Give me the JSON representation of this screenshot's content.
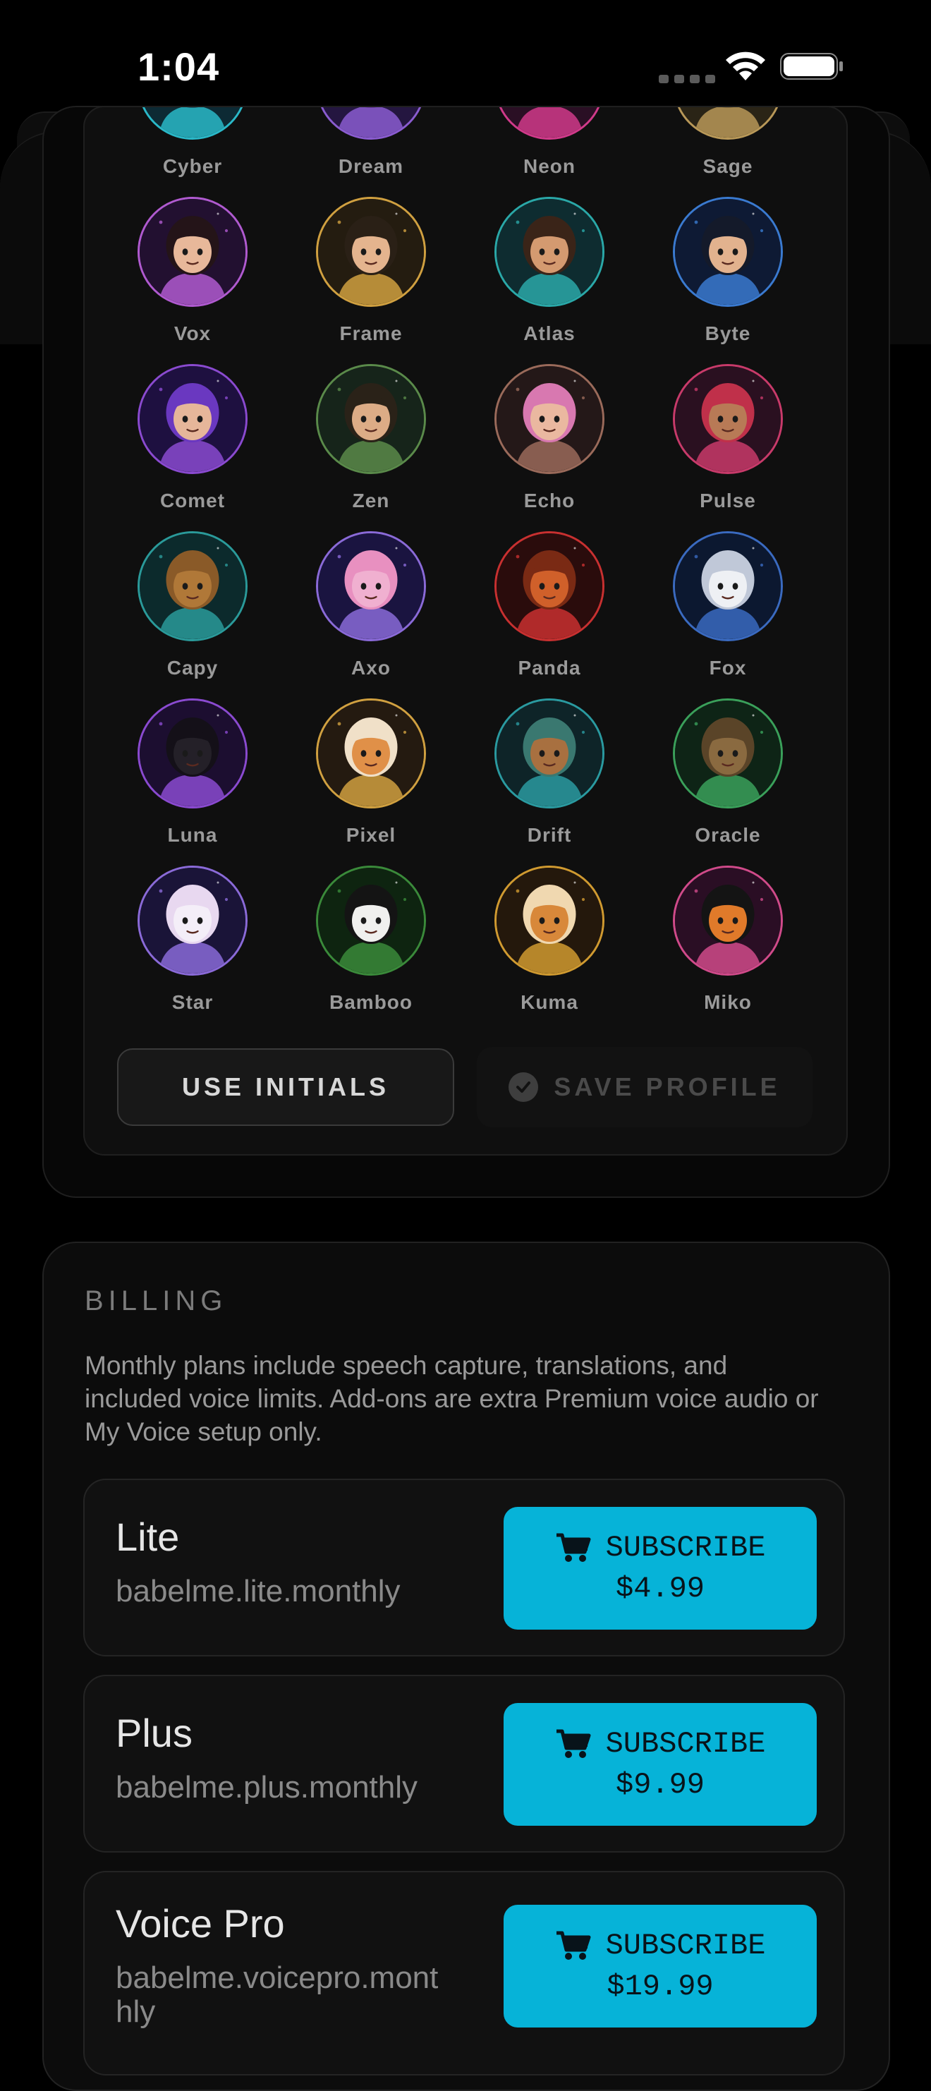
{
  "status_bar": {
    "time": "1:04"
  },
  "avatars": [
    {
      "name": "Cyber",
      "ring": "#2ab8c8",
      "bg": "#0d2a34",
      "skin": "#d9a27a",
      "hair": "#1a6070"
    },
    {
      "name": "Dream",
      "ring": "#8a5cd0",
      "bg": "#241640",
      "skin": "#e1b494",
      "hair": "#6a3aa0"
    },
    {
      "name": "Neon",
      "ring": "#d03a8a",
      "bg": "#2a0f24",
      "skin": "#e0ac8c",
      "hair": "#c02a7a"
    },
    {
      "name": "Sage",
      "ring": "#b89858",
      "bg": "#2a2416",
      "skin": "#d9a884",
      "hair": "#8a7040"
    },
    {
      "name": "Vox",
      "ring": "#b05ad0",
      "bg": "#221030",
      "skin": "#e8b89a",
      "hair": "#241418"
    },
    {
      "name": "Frame",
      "ring": "#d0a040",
      "bg": "#241c10",
      "skin": "#e4b48e",
      "hair": "#2a2016"
    },
    {
      "name": "Atlas",
      "ring": "#2aa8a8",
      "bg": "#0e2c30",
      "skin": "#d49a70",
      "hair": "#3a2418"
    },
    {
      "name": "Byte",
      "ring": "#3a7ad0",
      "bg": "#0e1a34",
      "skin": "#e2b28e",
      "hair": "#141a2a"
    },
    {
      "name": "Comet",
      "ring": "#8a4ad0",
      "bg": "#1e1040",
      "skin": "#e6b69a",
      "hair": "#6a38c0"
    },
    {
      "name": "Zen",
      "ring": "#5a8a4a",
      "bg": "#16241a",
      "skin": "#dcac86",
      "hair": "#2a2218"
    },
    {
      "name": "Echo",
      "ring": "#9a6a5a",
      "bg": "#241818",
      "skin": "#eab8a0",
      "hair": "#d878b0"
    },
    {
      "name": "Pulse",
      "ring": "#c83a6a",
      "bg": "#2a1020",
      "skin": "#b87a56",
      "hair": "#c0304a"
    },
    {
      "name": "Capy",
      "ring": "#2a9a9a",
      "bg": "#0c2a2c",
      "skin": "#b07838",
      "hair": "#8a5a28"
    },
    {
      "name": "Axo",
      "ring": "#8a6ad8",
      "bg": "#1a1440",
      "skin": "#f0b0d0",
      "hair": "#e890c0"
    },
    {
      "name": "Panda",
      "ring": "#c83030",
      "bg": "#2a0c0c",
      "skin": "#d0602a",
      "hair": "#7a2a14"
    },
    {
      "name": "Fox",
      "ring": "#3a6ac0",
      "bg": "#0c1830",
      "skin": "#eef0f4",
      "hair": "#c0c8d8"
    },
    {
      "name": "Luna",
      "ring": "#8a4ad0",
      "bg": "#1c0e30",
      "skin": "#242028",
      "hair": "#141018"
    },
    {
      "name": "Pixel",
      "ring": "#d0a040",
      "bg": "#241a10",
      "skin": "#e09048",
      "hair": "#f0e0c8"
    },
    {
      "name": "Drift",
      "ring": "#2a9aa0",
      "bg": "#0e2428",
      "skin": "#a87040",
      "hair": "#3a7870"
    },
    {
      "name": "Oracle",
      "ring": "#3aa05a",
      "bg": "#0e2416",
      "skin": "#8a6a40",
      "hair": "#5a4428"
    },
    {
      "name": "Star",
      "ring": "#8a6ad8",
      "bg": "#1a1438",
      "skin": "#f4eef8",
      "hair": "#e8d8f0"
    },
    {
      "name": "Bamboo",
      "ring": "#3a8a3a",
      "bg": "#0e2410",
      "skin": "#f0f0ee",
      "hair": "#141414"
    },
    {
      "name": "Kuma",
      "ring": "#d09a30",
      "bg": "#24180c",
      "skin": "#d8883a",
      "hair": "#f0d8b0"
    },
    {
      "name": "Miko",
      "ring": "#d04a8a",
      "bg": "#2a0e24",
      "skin": "#e07a2a",
      "hair": "#141414"
    }
  ],
  "profile_actions": {
    "use_initials": "USE INITIALS",
    "save_profile": "SAVE PROFILE"
  },
  "billing": {
    "heading": "BILLING",
    "description": "Monthly plans include speech capture, translations, and included voice limits. Add-ons are extra Premium voice audio or My Voice setup only.",
    "plans": [
      {
        "name": "Lite",
        "product_id": "babelme.lite.monthly",
        "button_label": "SUBSCRIBE",
        "price": "$4.99"
      },
      {
        "name": "Plus",
        "product_id": "babelme.plus.monthly",
        "button_label": "SUBSCRIBE",
        "price": "$9.99"
      },
      {
        "name": "Voice Pro",
        "product_id": "babelme.voicepro.monthly",
        "button_label": "SUBSCRIBE",
        "price": "$19.99"
      }
    ]
  },
  "colors": {
    "accent": "#06b3d8",
    "background": "#000000",
    "card": "#0c0c0c"
  }
}
